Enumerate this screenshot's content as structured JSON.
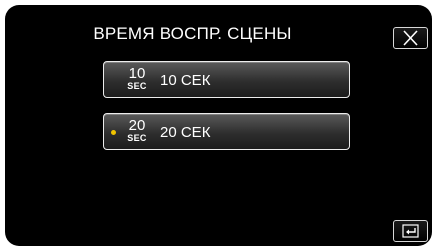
{
  "header": {
    "title": "ВРЕМЯ ВОСПР. СЦЕНЫ",
    "close_icon": "close-icon"
  },
  "options": [
    {
      "icon_number": "10",
      "icon_unit": "SEC",
      "label": "10 СЕК",
      "selected": false
    },
    {
      "icon_number": "20",
      "icon_unit": "SEC",
      "label": "20 СЕК",
      "selected": true
    }
  ],
  "footer": {
    "back_icon": "return-icon"
  },
  "colors": {
    "background": "#000000",
    "text": "#ffffff",
    "selection_dot": "#f0c400"
  }
}
